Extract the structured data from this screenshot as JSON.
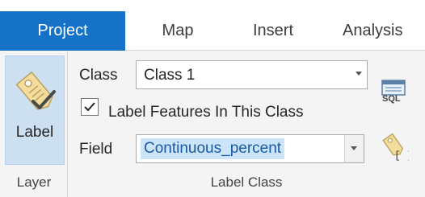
{
  "tabs": [
    {
      "label": "Project",
      "active": true
    },
    {
      "label": "Map",
      "active": false
    },
    {
      "label": "Insert",
      "active": false
    },
    {
      "label": "Analysis",
      "active": false
    }
  ],
  "layer_group": {
    "button_label": "Label",
    "caption": "Layer",
    "icon": "label-tag-icon"
  },
  "label_class_group": {
    "class_label": "Class",
    "class_value": "Class 1",
    "checkbox_label": "Label Features In This Class",
    "checkbox_checked": true,
    "field_label": "Field",
    "field_value": "Continuous_percent",
    "caption": "Label Class",
    "sql_button_text": "SQL",
    "sql_icon": "sql-query-icon",
    "expression_icon": "label-expression-icon"
  },
  "colors": {
    "active_tab": "#1572c6",
    "selected_button": "#cde0f1",
    "text_highlight": "#cce4f7"
  }
}
